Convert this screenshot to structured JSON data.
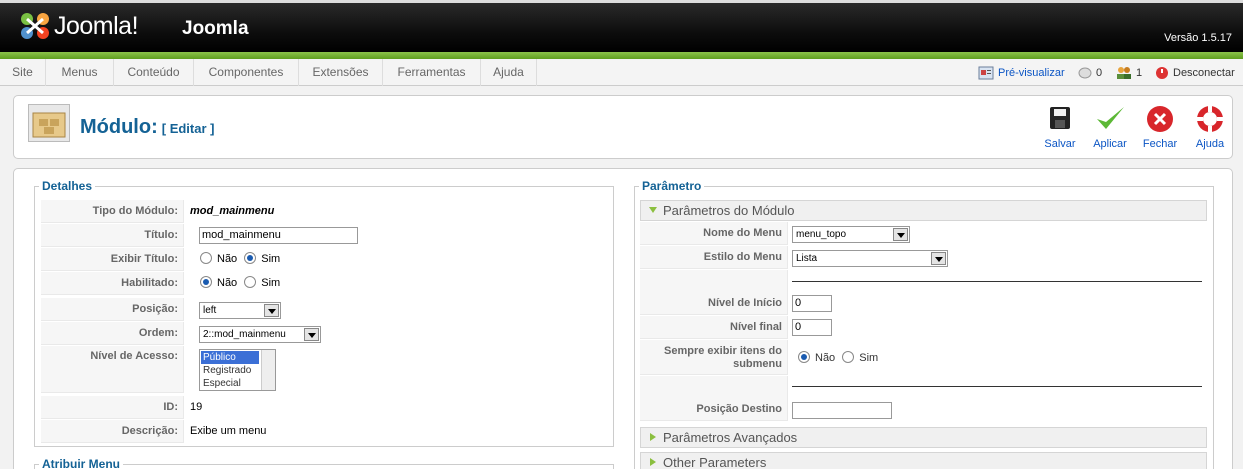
{
  "header": {
    "logo_text": "Joomla!",
    "site_name": "Joomla",
    "version": "Versão 1.5.17"
  },
  "menu": [
    {
      "label": "Site"
    },
    {
      "label": "Menus"
    },
    {
      "label": "Conteúdo"
    },
    {
      "label": "Componentes"
    },
    {
      "label": "Extensões"
    },
    {
      "label": "Ferramentas"
    },
    {
      "label": "Ajuda"
    }
  ],
  "status": {
    "preview": "Pré-visualizar",
    "messages": "0",
    "users": "1",
    "logout": "Desconectar"
  },
  "toolbar": {
    "title": "Módulo:",
    "subtitle": "[ Editar ]",
    "buttons": [
      {
        "label": "Salvar"
      },
      {
        "label": "Aplicar"
      },
      {
        "label": "Fechar"
      },
      {
        "label": "Ajuda"
      }
    ]
  },
  "details": {
    "legend": "Detalhes",
    "tipo_label": "Tipo do Módulo:",
    "tipo_value": "mod_mainmenu",
    "titulo_label": "Título:",
    "titulo_value": "mod_mainmenu",
    "exibir_label": "Exibir Título:",
    "exibir_no": "Não",
    "exibir_yes": "Sim",
    "exibir_selected": "Sim",
    "habilitado_label": "Habilitado:",
    "habilitado_no": "Não",
    "habilitado_yes": "Sim",
    "habilitado_selected": "Não",
    "posicao_label": "Posição:",
    "posicao_value": "left",
    "ordem_label": "Ordem:",
    "ordem_value": "2::mod_mainmenu",
    "acesso_label": "Nível de Acesso:",
    "acesso_options": [
      "Público",
      "Registrado",
      "Especial"
    ],
    "acesso_selected": "Público",
    "id_label": "ID:",
    "id_value": "19",
    "descricao_label": "Descrição:",
    "descricao_value": "Exibe um menu"
  },
  "atribuir": {
    "legend": "Atribuir Menu"
  },
  "params": {
    "legend": "Parâmetro",
    "module_panel": "Parâmetros do Módulo",
    "nome_menu_label": "Nome do Menu",
    "nome_menu_value": "menu_topo",
    "estilo_label": "Estilo do Menu",
    "estilo_value": "Lista",
    "nivel_inicio_label": "Nível de Início",
    "nivel_inicio_value": "0",
    "nivel_final_label": "Nível final",
    "nivel_final_value": "0",
    "sempre_label": "Sempre exibir itens do submenu",
    "sempre_no": "Não",
    "sempre_yes": "Sim",
    "sempre_selected": "Não",
    "posicao_destino_label": "Posição Destino",
    "posicao_destino_value": "",
    "advanced_panel": "Parâmetros Avançados",
    "other_panel": "Other Parameters"
  }
}
